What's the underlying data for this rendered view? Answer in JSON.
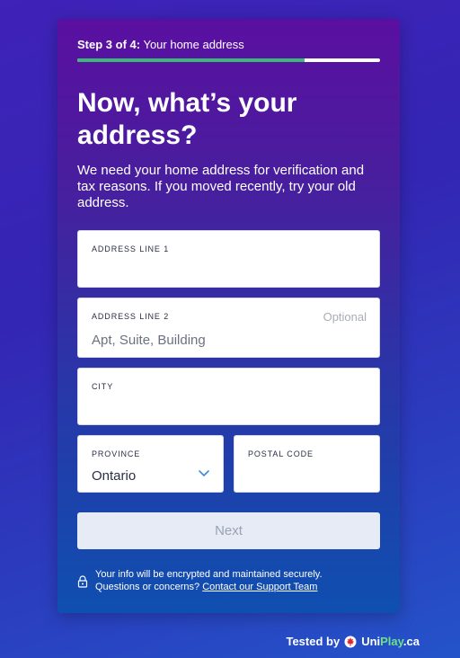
{
  "progress": {
    "step_label": "Step 3 of 4:",
    "step_title": "Your home address",
    "fraction": 0.75,
    "fill_color": "#3cb878"
  },
  "heading": {
    "title": "Now, what’s your address?",
    "subtitle": "We need your home address for verification and tax reasons. If you moved recently, try your old address."
  },
  "fields": {
    "address1": {
      "label": "ADDRESS LINE 1",
      "value": "",
      "placeholder": ""
    },
    "address2": {
      "label": "ADDRESS LINE 2",
      "optional": "Optional",
      "value": "",
      "placeholder": "Apt, Suite, Building"
    },
    "city": {
      "label": "CITY",
      "value": "",
      "placeholder": ""
    },
    "province": {
      "label": "PROVINCE",
      "value": "Ontario"
    },
    "postal": {
      "label": "POSTAL CODE",
      "value": "",
      "placeholder": ""
    }
  },
  "actions": {
    "next_label": "Next"
  },
  "security": {
    "line1": "Your info will be encrypted and maintained securely.",
    "line2_prefix": "Questions or concerns?",
    "support_link": "Contact our Support Team"
  },
  "footer": {
    "tested_by": "Tested by",
    "brand_uni": "Uni",
    "brand_play": "Play",
    "brand_tld": ".ca"
  },
  "icons": {
    "lock": "lock-icon",
    "chevron": "chevron-down-icon",
    "leaf": "maple-leaf-icon"
  },
  "colors": {
    "accent": "#3cb878",
    "chevron": "#3a8be0",
    "leaf": "#e0262e"
  }
}
